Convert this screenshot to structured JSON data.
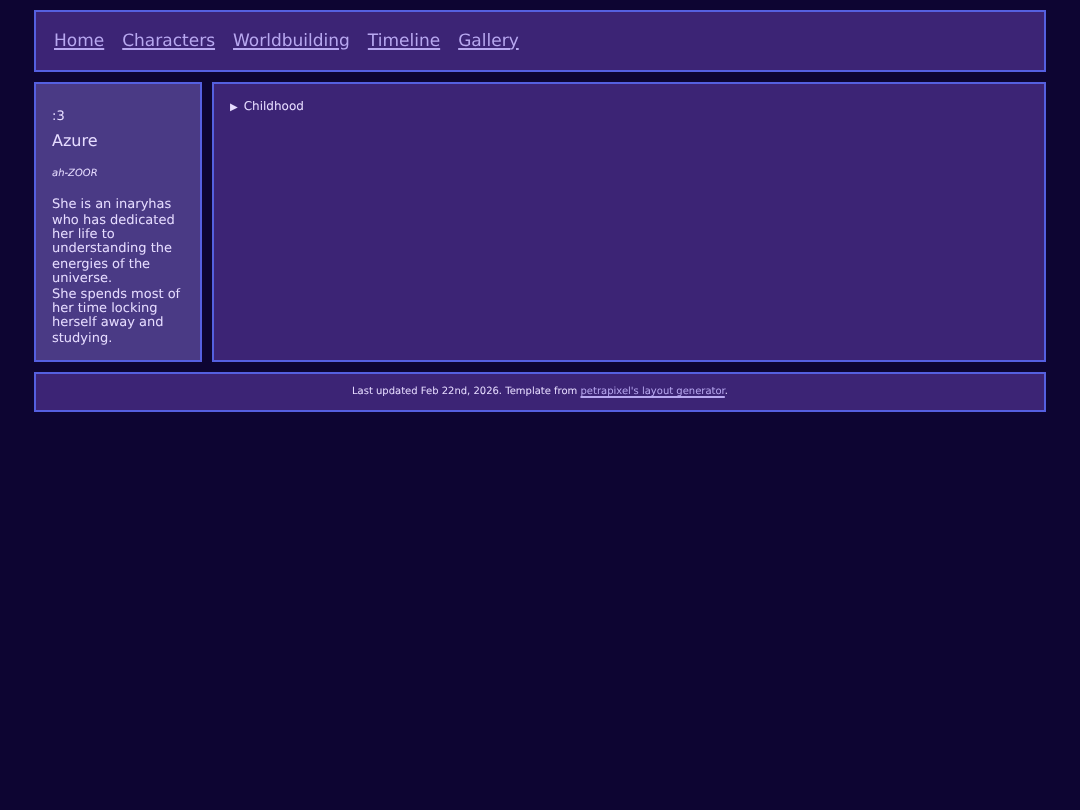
{
  "nav": {
    "links": [
      "Home",
      "Characters",
      "Worldbuilding",
      "Timeline",
      "Gallery"
    ]
  },
  "sidebar": {
    "emote": ":3",
    "name": "Azure",
    "pronunciation": "ah-ZOOR",
    "bio": [
      "She is an inaryhas who has dedicated her life to understanding the energies of the universe.",
      "She spends most of her time locking herself away and studying."
    ]
  },
  "main": {
    "sections": [
      {
        "marker": "▶",
        "label": "Childhood"
      }
    ]
  },
  "footer": {
    "text": "Last updated Feb 22nd, 2026. Template from ",
    "link": "petrapixel's layout generator",
    "end": "."
  }
}
